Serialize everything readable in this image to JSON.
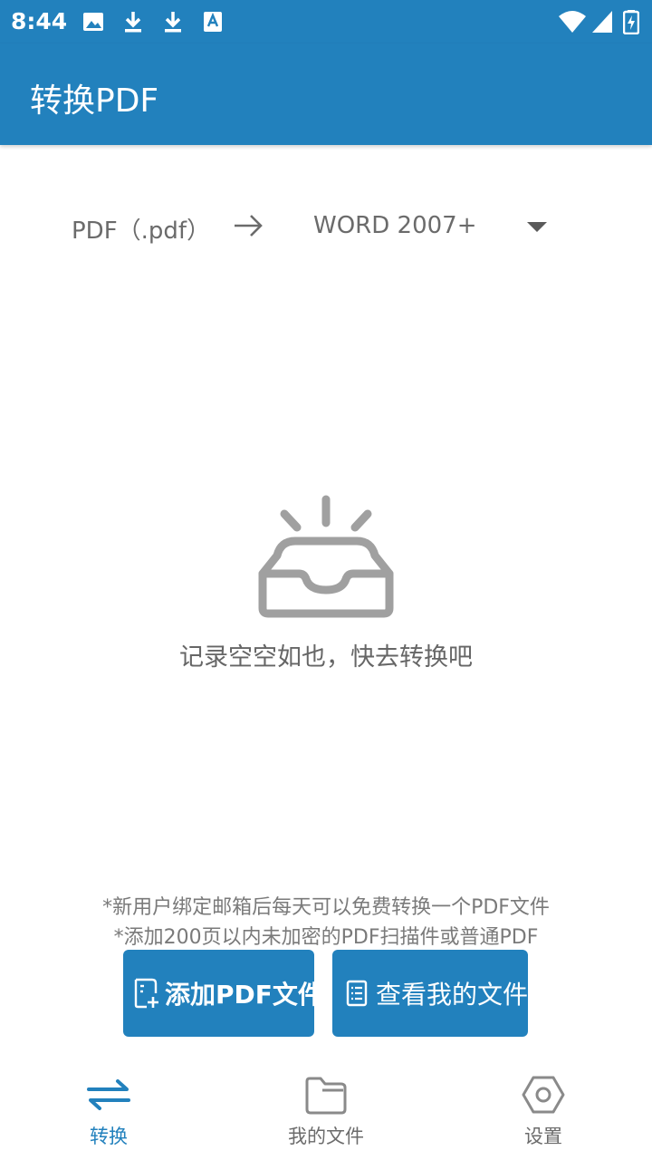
{
  "status_bar": {
    "time": "8:44",
    "left_icons": [
      "image-icon",
      "download-icon",
      "download-icon",
      "font-icon"
    ],
    "right_icons": [
      "wifi-icon",
      "signal-icon",
      "battery-charging-icon"
    ]
  },
  "app_bar": {
    "title": "转换PDF"
  },
  "converter": {
    "from_format": "PDF（.pdf）",
    "arrow_icon": "arrow-right-icon",
    "to_format": "WORD 2007+",
    "dropdown_icon": "dropdown-triangle-icon"
  },
  "empty_state": {
    "icon": "empty-inbox-icon",
    "text": "记录空空如也，快去转换吧"
  },
  "notes": {
    "line1": "*新用户绑定邮箱后每天可以免费转换一个PDF文件",
    "line2": "*添加200页以内未加密的PDF扫描件或普通PDF"
  },
  "buttons": {
    "add_pdf": {
      "label": "添加PDF文件",
      "icon": "add-file-icon"
    },
    "view_files": {
      "label": "查看我的文件",
      "icon": "document-list-icon"
    }
  },
  "bottom_nav": {
    "items": [
      {
        "label": "转换",
        "icon": "swap-arrows-icon",
        "active": true
      },
      {
        "label": "我的文件",
        "icon": "folder-icon",
        "active": false
      },
      {
        "label": "设置",
        "icon": "hexagon-settings-icon",
        "active": false
      }
    ]
  },
  "colors": {
    "primary": "#2281bd",
    "text_gray": "#6b6b6b",
    "icon_gray": "#a0a0a0"
  }
}
